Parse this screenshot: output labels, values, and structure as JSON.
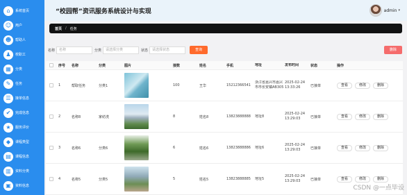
{
  "app": {
    "title": "“校园帮”资讯服务系统设计与实现"
  },
  "user": {
    "name": "admin",
    "caret": "▾"
  },
  "sidebar": {
    "items": [
      {
        "label": "系统首页",
        "icon": "home-icon"
      },
      {
        "label": "用户",
        "icon": "user-icon"
      },
      {
        "label": "帮助人",
        "icon": "helper-icon"
      },
      {
        "label": "校职工",
        "icon": "staff-icon"
      },
      {
        "label": "分类",
        "icon": "category-icon"
      },
      {
        "label": "任务",
        "icon": "task-icon"
      },
      {
        "label": "接单信息",
        "icon": "order-icon"
      },
      {
        "label": "完成信息",
        "icon": "complete-icon"
      },
      {
        "label": "服务评价",
        "icon": "review-icon"
      },
      {
        "label": "课程类型",
        "icon": "course-type-icon"
      },
      {
        "label": "课程信息",
        "icon": "course-icon"
      },
      {
        "label": "资料分类",
        "icon": "material-category-icon"
      },
      {
        "label": "资料信息",
        "icon": "material-icon"
      }
    ]
  },
  "breadcrumb": {
    "home": "首页",
    "sep": "/",
    "current": "任务"
  },
  "search": {
    "name_label": "名称",
    "name_placeholder": "名称",
    "category_label": "分类",
    "category_placeholder": "请选择分类",
    "status_label": "状态",
    "status_placeholder": "请选择状态",
    "search_button": "查询",
    "delete_button": "删除"
  },
  "table": {
    "headers": [
      "序号",
      "名称",
      "分类",
      "图片",
      "接数",
      "姓名",
      "手机",
      "地址",
      "发布时间",
      "状态",
      "操作"
    ],
    "rows": [
      {
        "no": "1",
        "name": "帮取任务",
        "category": "分类1",
        "views": "100",
        "author": "王华",
        "phone": "15212366541",
        "address": "浙江省嘉兴市嘉兴市市长安镇AB305",
        "time": "2025-02-24 13:33:26",
        "status": "已接单",
        "image": "phone-photo"
      },
      {
        "no": "2",
        "name": "名称8",
        "category": "家纺洗",
        "views": "8",
        "author": "姓名8",
        "phone": "13823888888",
        "address": "地址8",
        "time": "2025-02-24 13:29:03",
        "status": "已接单",
        "image": "building-photo"
      },
      {
        "no": "3",
        "name": "名称6",
        "category": "分类6",
        "views": "6",
        "author": "姓名6",
        "phone": "13823888886",
        "address": "地址6",
        "time": "2025-02-24 13:29:03",
        "status": "已接单",
        "image": "trees-photo"
      },
      {
        "no": "4",
        "name": "名称5",
        "category": "分类5",
        "views": "5",
        "author": "姓名5",
        "phone": "13823888885",
        "address": "地址5",
        "time": "2025-02-24 13:29:03",
        "status": "已接单",
        "image": "campus-photo"
      }
    ],
    "actions": {
      "view": "查看",
      "edit": "修改",
      "delete": "删除"
    }
  },
  "watermark": "CSDN @一点毕设",
  "colors": {
    "sidebar": "#2a8dee",
    "search_button": "#ff6a2c",
    "delete_button": "#f56c6c",
    "crumbbar": "#121212"
  }
}
